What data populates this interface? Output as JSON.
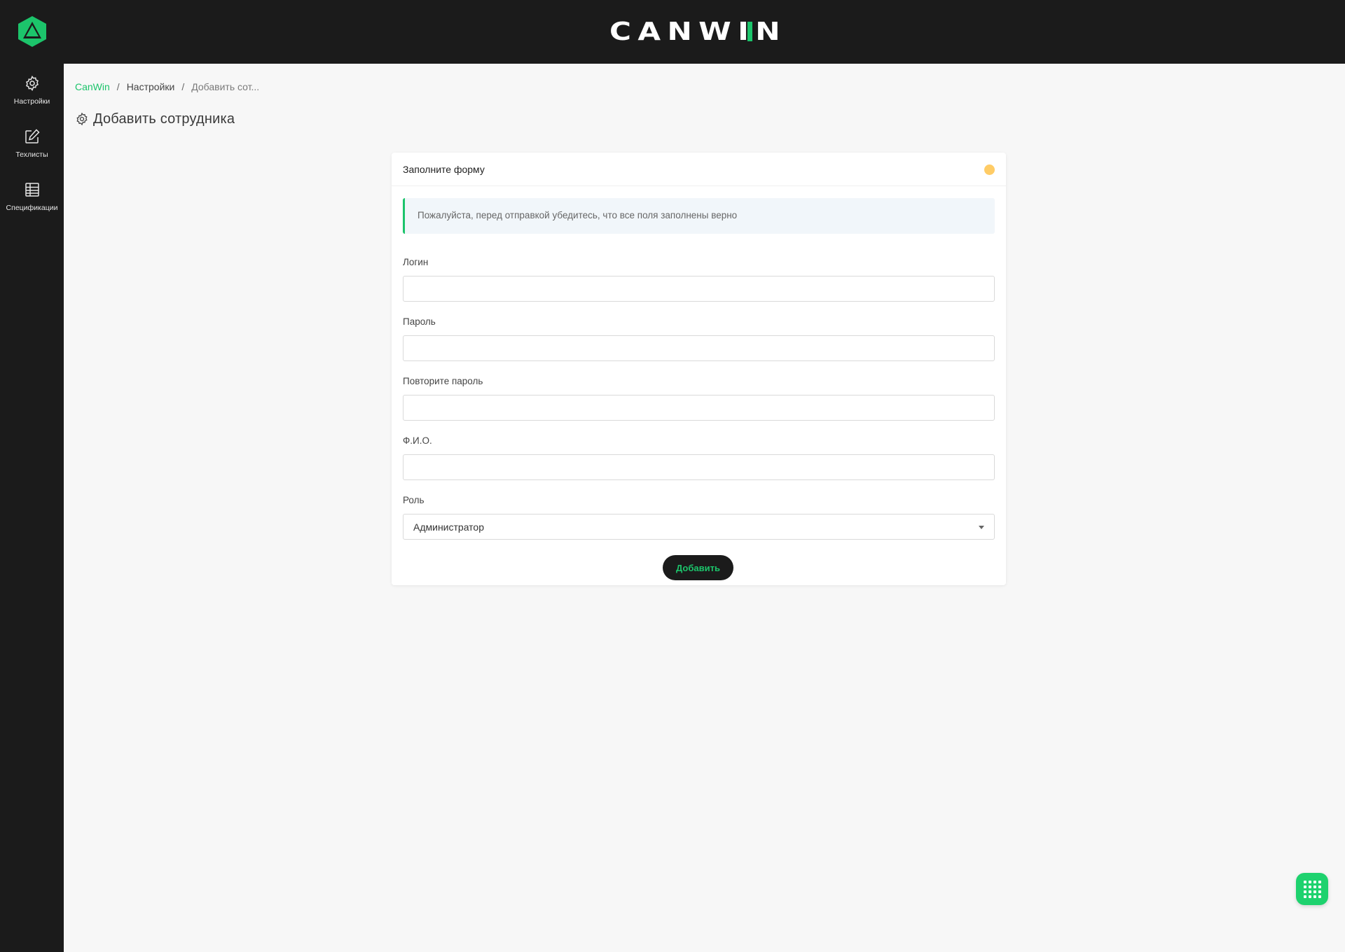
{
  "header": {
    "logo_text": "CANWIN",
    "colors": {
      "background": "#1b1b1b",
      "accent": "#1cc46b"
    }
  },
  "sidebar": {
    "items": [
      {
        "label": "Настройки",
        "icon": "gear-icon"
      },
      {
        "label": "Техлисты",
        "icon": "edit-icon"
      },
      {
        "label": "Спецификации",
        "icon": "table-icon"
      }
    ]
  },
  "breadcrumb": {
    "items": [
      "CanWin",
      "Настройки",
      "Добавить сот..."
    ],
    "separator": "/"
  },
  "page": {
    "title": "Добавить сотрудника",
    "title_icon": "gear-icon"
  },
  "form": {
    "header_title": "Заполните форму",
    "status_dot_color": "#ffcc66",
    "alert_text": "Пожалуйста, перед отправкой убедитесь, что все поля заполнены верно",
    "fields": [
      {
        "label": "Логин",
        "value": "",
        "placeholder": ""
      },
      {
        "label": "Пароль",
        "value": "",
        "placeholder": ""
      },
      {
        "label": "Повторите пароль",
        "value": "",
        "placeholder": ""
      },
      {
        "label": "Ф.И.О.",
        "value": "",
        "placeholder": ""
      }
    ],
    "role": {
      "label": "Роль",
      "selected": "Администратор"
    },
    "submit_label": "Добавить"
  },
  "fab": {
    "icon": "grid-icon",
    "color": "#1ed26e"
  }
}
